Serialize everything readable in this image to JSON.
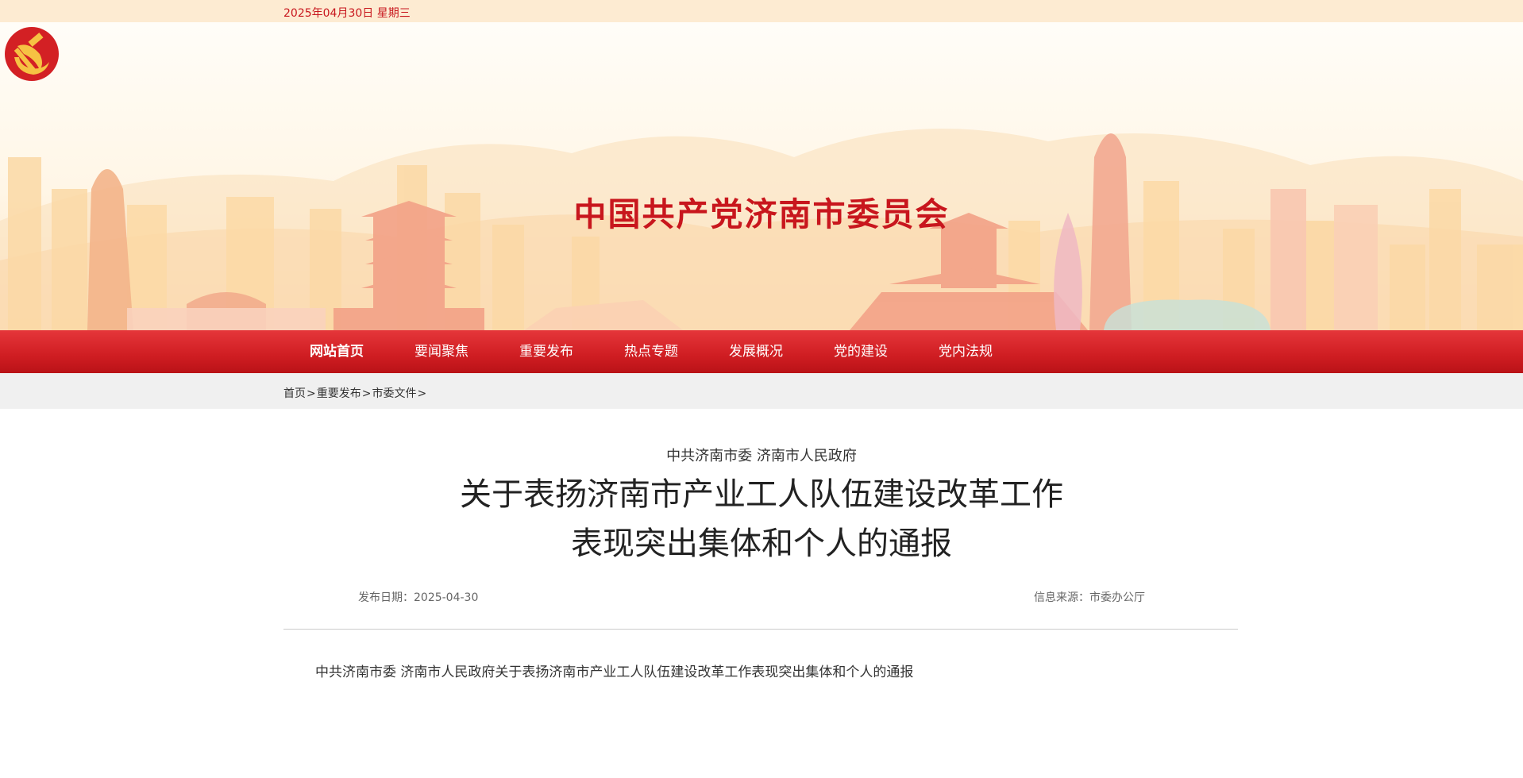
{
  "header": {
    "date": "2025年04月30日 星期三",
    "site_title": "中国共产党济南市委员会"
  },
  "nav": {
    "items": [
      "网站首页",
      "要闻聚焦",
      "重要发布",
      "热点专题",
      "发展概况",
      "党的建设",
      "党内法规"
    ],
    "active_index": 0
  },
  "breadcrumb": {
    "items": [
      "首页",
      "重要发布",
      "市委文件"
    ],
    "separator": ">"
  },
  "article": {
    "issuer": "中共济南市委 济南市人民政府",
    "title_line1": "关于表扬济南市产业工人队伍建设改革工作",
    "title_line2": "表现突出集体和个人的通报",
    "publish_label": "发布日期：2025-04-30",
    "source_label": "信息来源：市委办公厅",
    "body": "中共济南市委 济南市人民政府关于表扬济南市产业工人队伍建设改革工作表现突出集体和个人的通报"
  },
  "colors": {
    "brand_red": "#c8161d",
    "nav_red": "#d42026",
    "top_bar": "#fdebd2",
    "breadcrumb_bg": "#f0f0f0"
  },
  "icons": {
    "emblem": "party-emblem-icon"
  }
}
